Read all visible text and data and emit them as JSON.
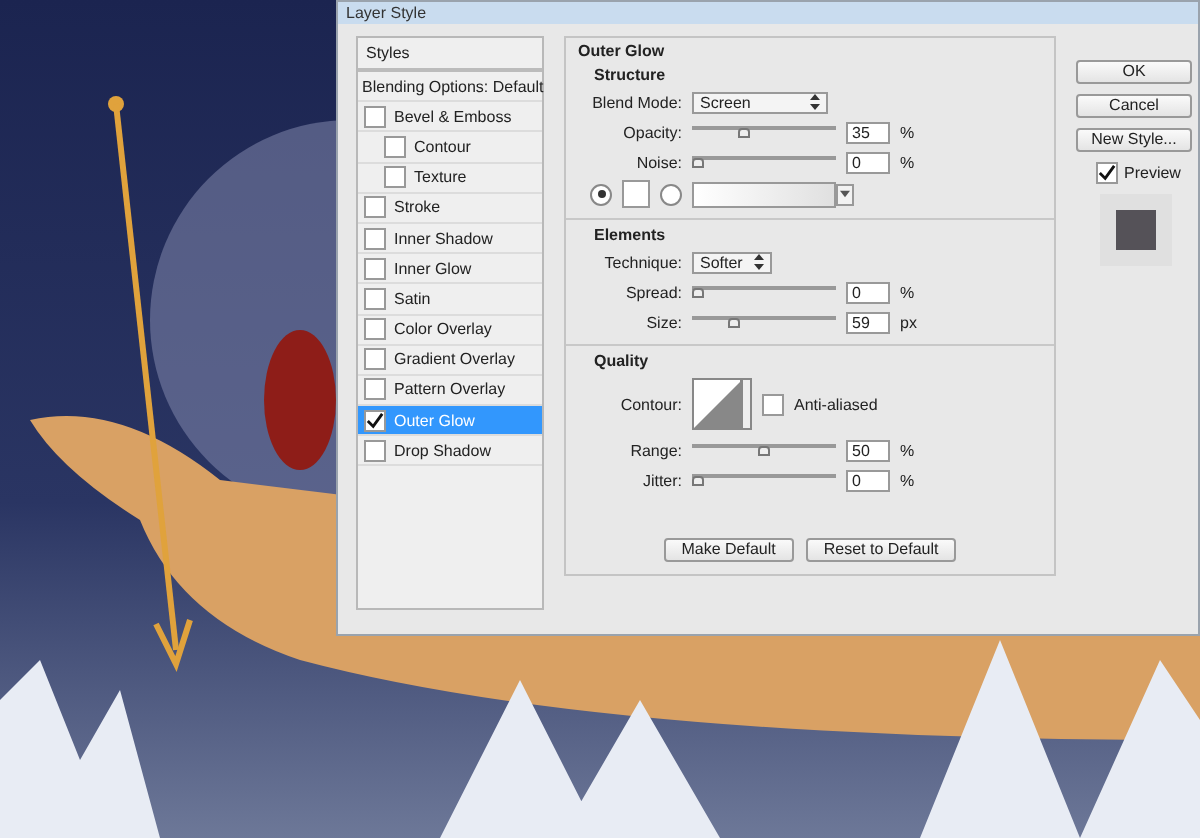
{
  "dialog": {
    "title": "Layer Style",
    "styles": {
      "header": "Styles",
      "blending": "Blending Options: Default",
      "items": [
        {
          "label": "Bevel & Emboss",
          "kind": "effect",
          "checked": false,
          "selected": false
        },
        {
          "label": "Contour",
          "kind": "sub",
          "checked": false,
          "selected": false
        },
        {
          "label": "Texture",
          "kind": "sub",
          "checked": false,
          "selected": false
        },
        {
          "label": "Stroke",
          "kind": "effect",
          "checked": false,
          "selected": false
        },
        {
          "label": "Inner Shadow",
          "kind": "effect",
          "checked": false,
          "selected": false
        },
        {
          "label": "Inner Glow",
          "kind": "effect",
          "checked": false,
          "selected": false
        },
        {
          "label": "Satin",
          "kind": "effect",
          "checked": false,
          "selected": false
        },
        {
          "label": "Color Overlay",
          "kind": "effect",
          "checked": false,
          "selected": false
        },
        {
          "label": "Gradient Overlay",
          "kind": "effect",
          "checked": false,
          "selected": false
        },
        {
          "label": "Pattern Overlay",
          "kind": "effect",
          "checked": false,
          "selected": false
        },
        {
          "label": "Outer Glow",
          "kind": "effect",
          "checked": true,
          "selected": true
        },
        {
          "label": "Drop Shadow",
          "kind": "effect",
          "checked": false,
          "selected": false
        }
      ]
    },
    "outer_glow": {
      "title": "Outer Glow",
      "structure": {
        "title": "Structure",
        "blend_mode": {
          "label": "Blend Mode:",
          "value": "Screen"
        },
        "sliders": [
          {
            "label": "Opacity:",
            "level": 0.35,
            "value": "35",
            "unit": "%"
          },
          {
            "label": "Noise:",
            "level": 0,
            "value": "0",
            "unit": "%"
          }
        ],
        "fill": [
          {
            "kind": "color",
            "selected": true
          },
          {
            "kind": "gradient",
            "selected": false
          }
        ]
      },
      "elements": {
        "title": "Elements",
        "technique": {
          "label": "Technique:",
          "value": "Softer"
        },
        "sliders": [
          {
            "label": "Spread:",
            "level": 0,
            "value": "0",
            "unit": "%"
          },
          {
            "label": "Size:",
            "level": 0.28,
            "value": "59",
            "unit": "px"
          }
        ]
      },
      "quality": {
        "title": "Quality",
        "contour_label": "Contour:",
        "anti_aliased": {
          "label": "Anti-aliased",
          "checked": false
        },
        "sliders": [
          {
            "label": "Range:",
            "level": 0.5,
            "value": "50",
            "unit": "%"
          },
          {
            "label": "Jitter:",
            "level": 0,
            "value": "0",
            "unit": "%"
          }
        ]
      },
      "buttons": [
        "Make Default",
        "Reset to Default"
      ]
    },
    "side_buttons": [
      "OK",
      "Cancel",
      "New Style..."
    ],
    "preview": {
      "label": "Preview",
      "checked": true
    }
  }
}
